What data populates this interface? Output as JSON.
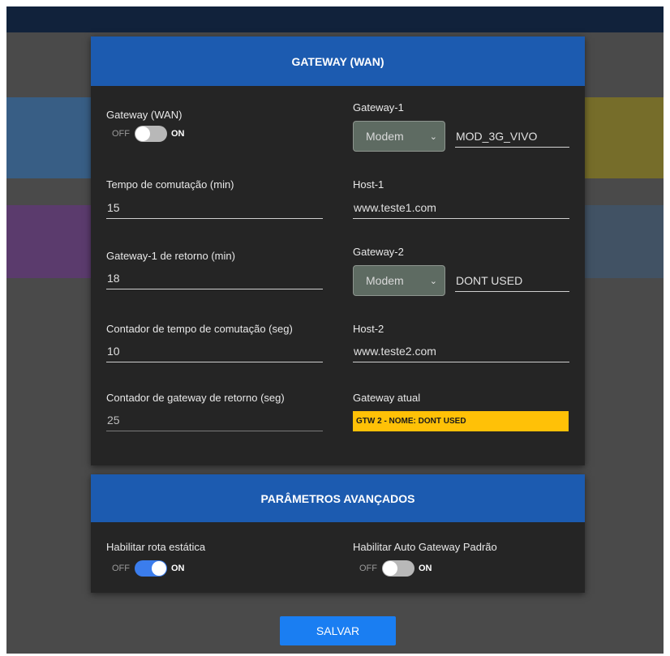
{
  "gateway_section": {
    "title": "GATEWAY (WAN)",
    "gateway_wan": {
      "label": "Gateway (WAN)",
      "off_label": "OFF",
      "on_label": "ON",
      "state": "off"
    },
    "tempo_comutacao": {
      "label": "Tempo de comutação (min)",
      "value": "15"
    },
    "gateway1_retorno": {
      "label": "Gateway-1 de retorno (min)",
      "value": "18"
    },
    "contador_tempo": {
      "label": "Contador de tempo de comutação (seg)",
      "value": "10"
    },
    "contador_gateway": {
      "label": "Contador de gateway de retorno (seg)",
      "value": "25"
    },
    "gateway1": {
      "label": "Gateway-1",
      "type": "Modem",
      "name": "MOD_3G_VIVO"
    },
    "host1": {
      "label": "Host-1",
      "value": "www.teste1.com"
    },
    "gateway2": {
      "label": "Gateway-2",
      "type": "Modem",
      "name": "DONT USED"
    },
    "host2": {
      "label": "Host-2",
      "value": "www.teste2.com"
    },
    "gateway_atual": {
      "label": "Gateway atual",
      "value": "GTW 2 - NOME: DONT USED",
      "color": "#ffc107"
    }
  },
  "advanced_section": {
    "title": "PARÂMETROS AVANÇADOS",
    "rota_estatica": {
      "label": "Habilitar rota estática",
      "off_label": "OFF",
      "on_label": "ON",
      "state": "on"
    },
    "auto_gateway": {
      "label": "Habilitar Auto Gateway Padrão",
      "off_label": "OFF",
      "on_label": "ON",
      "state": "off"
    }
  },
  "save_label": "SALVAR",
  "colors": {
    "header": "#1c5bb0",
    "accent": "#3b7ded",
    "save": "#1a7ef2",
    "card": "#252525"
  }
}
